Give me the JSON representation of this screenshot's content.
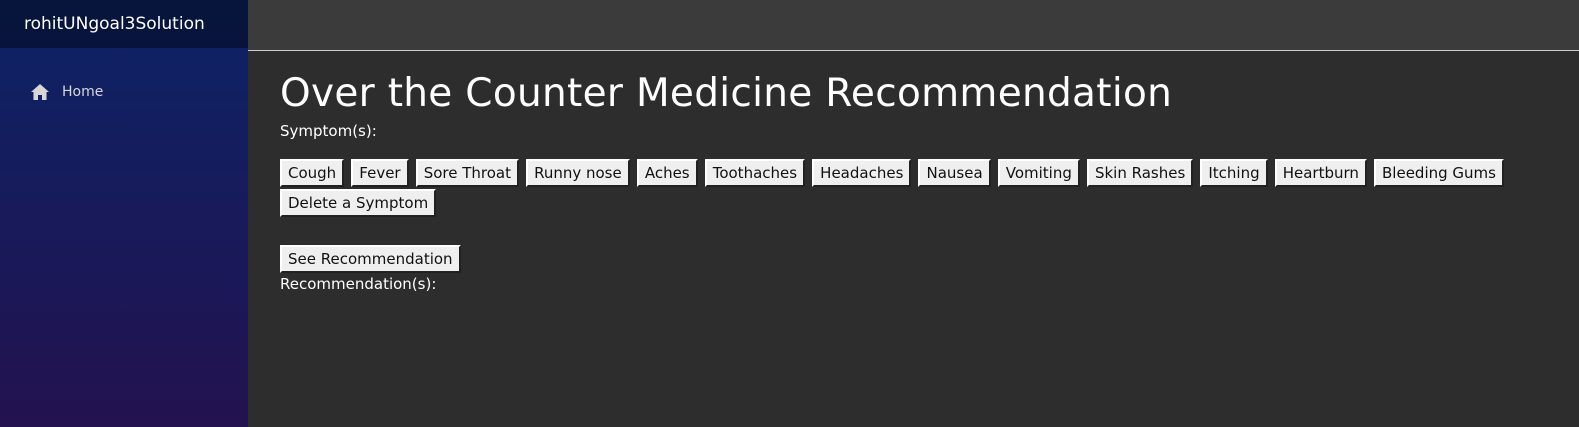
{
  "app": {
    "brand": "rohitUNgoal3Solution"
  },
  "nav": {
    "items": [
      {
        "label": "Home",
        "icon": "home-icon"
      }
    ]
  },
  "page": {
    "title": "Over the Counter Medicine Recommendation",
    "symptoms_label": "Symptom(s):",
    "symptom_buttons": [
      "Cough",
      "Fever",
      "Sore Throat",
      "Runny nose",
      "Aches",
      "Toothaches",
      "Headaches",
      "Nausea",
      "Vomiting",
      "Skin Rashes",
      "Itching",
      "Heartburn",
      "Bleeding Gums",
      "Delete a Symptom"
    ],
    "recommend_button": "See Recommendation",
    "recommendations_label": "Recommendation(s):"
  },
  "colors": {
    "sidebar_top": "#0c2366",
    "sidebar_bottom": "#23124f",
    "topbar": "#3b3b3b",
    "main_bg": "#2d2d2d",
    "button_bg": "#efefef"
  }
}
